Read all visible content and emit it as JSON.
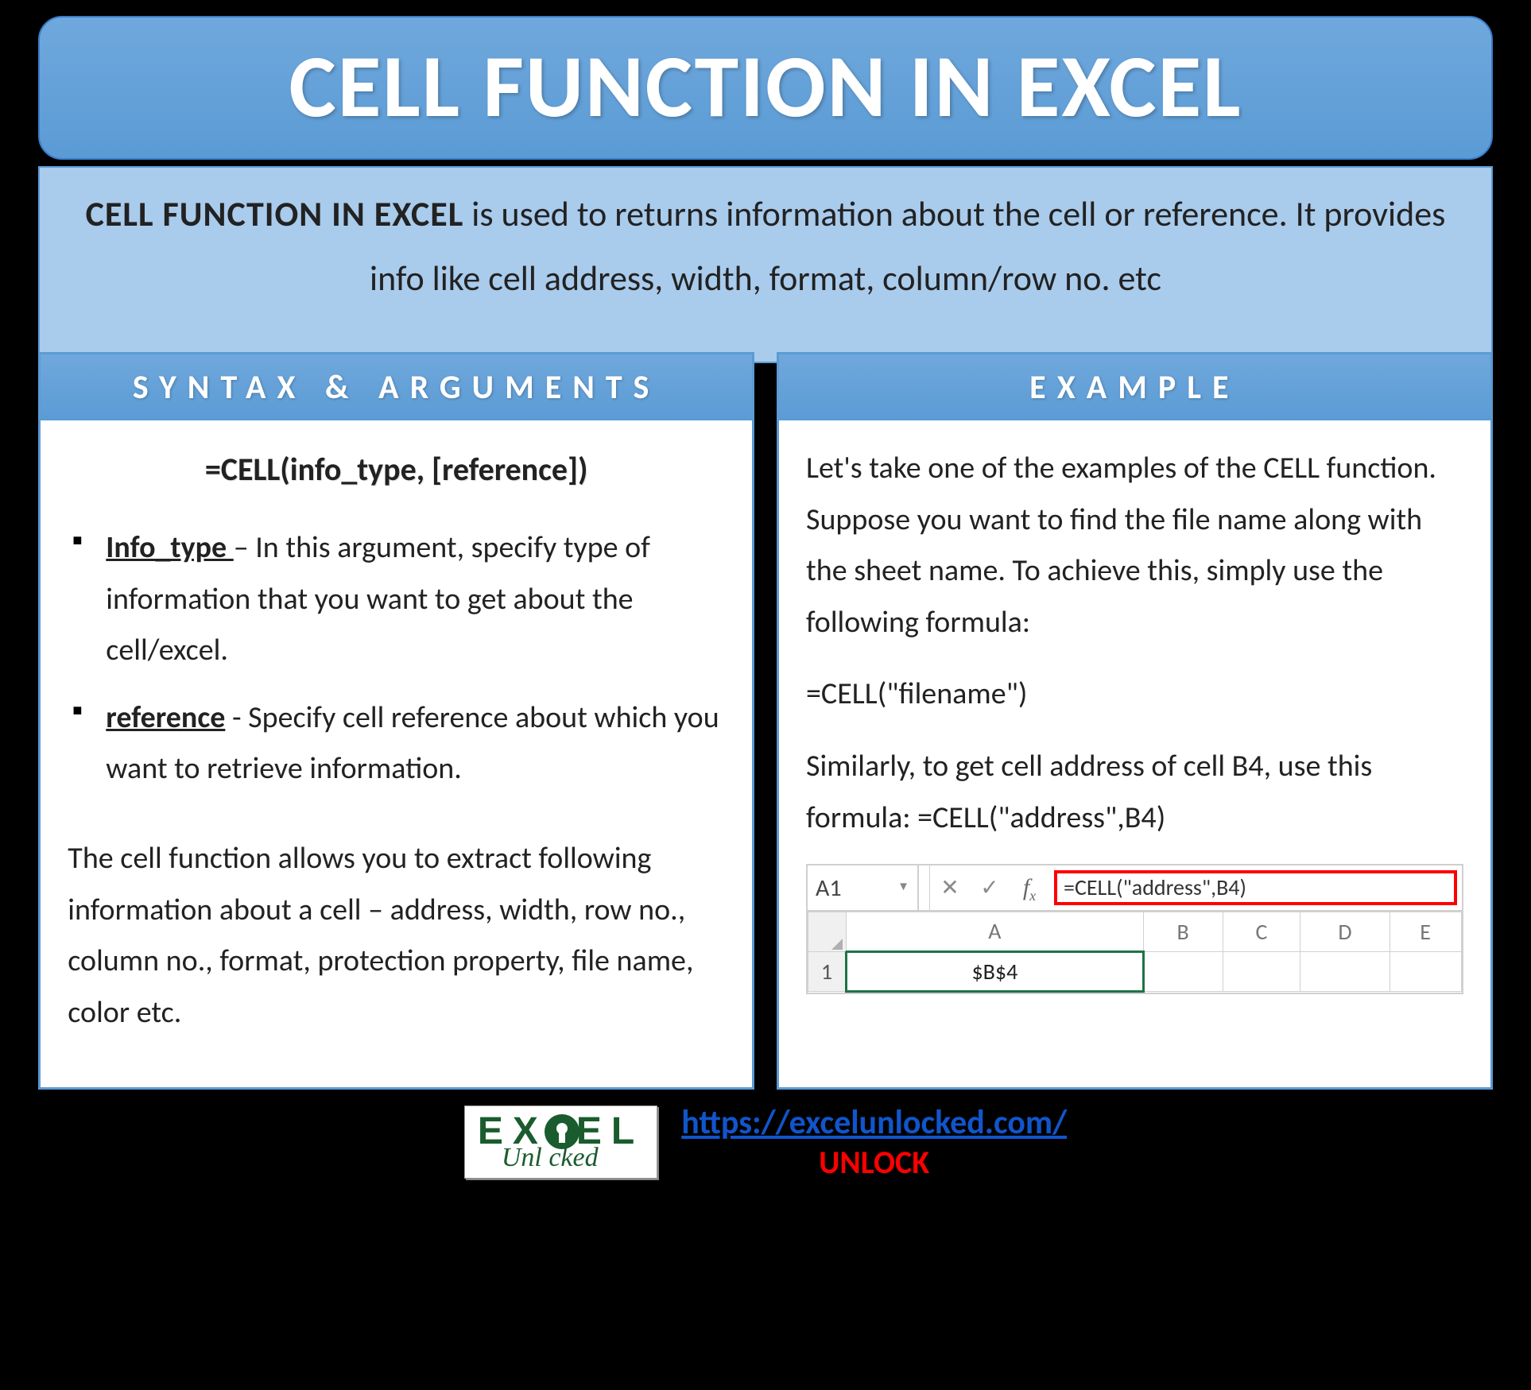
{
  "title": "CELL FUNCTION IN EXCEL",
  "intro": {
    "strong": "CELL FUNCTION IN EXCEL",
    "rest": " is used to returns information about the cell or reference. It provides info like cell address, width, format, column/row no. etc"
  },
  "left": {
    "header": "SYNTAX & ARGUMENTS",
    "syntax": "=CELL(info_type, [reference])",
    "args": [
      {
        "term": "Info_type ",
        "desc": "– In this argument, specify type of information that you want to get about the cell/excel."
      },
      {
        "term": "reference",
        "desc": " - Specify cell reference about which you want to retrieve information."
      }
    ],
    "summary": "The cell function allows you to extract following information about a cell – address, width, row no., column no., format, protection property, file name, color etc."
  },
  "right": {
    "header": "EXAMPLE",
    "p1": "Let's take one of the examples of the CELL function. Suppose you want to find the file name along with the sheet name. To achieve this, simply use the following formula:",
    "formula1": "=CELL(\"filename\")",
    "p2": "Similarly, to get cell address of cell B4, use this formula: =CELL(\"address\",B4)",
    "excel": {
      "namebox": "A1",
      "fx_input": "=CELL(\"address\",B4)",
      "columns": [
        "",
        "A",
        "B",
        "C",
        "D",
        "E"
      ],
      "row_label": "1",
      "a1_value": "$B$4"
    }
  },
  "footer": {
    "logo_top_left": "EX",
    "logo_top_right": "EL",
    "logo_bottom": "Unl   cked",
    "url": "https://excelunlocked.com/",
    "unlock": "UNLOCK"
  }
}
